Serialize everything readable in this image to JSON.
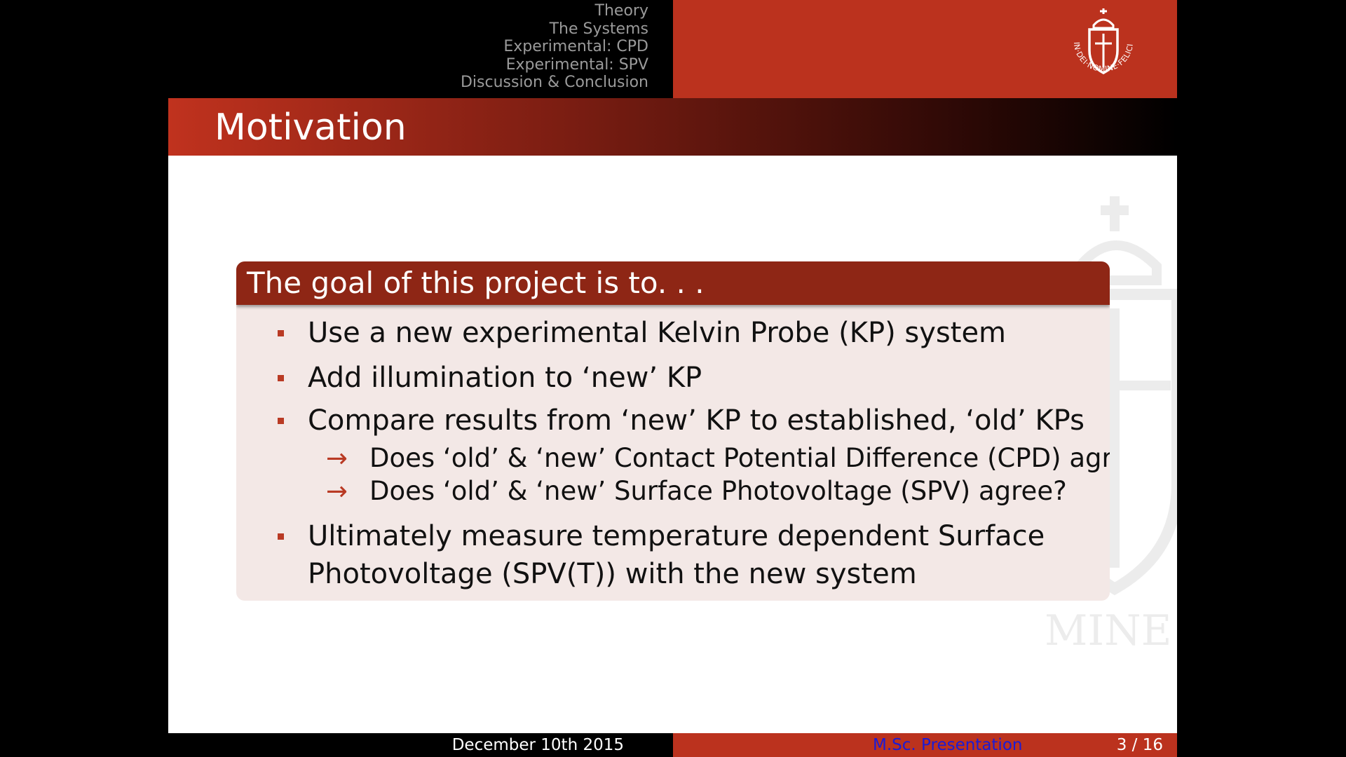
{
  "nav": {
    "sections": [
      "Theory",
      "The Systems",
      "Experimental: CPD",
      "Experimental: SPV",
      "Discussion & Conclusion"
    ]
  },
  "logo": {
    "motto": "IN·DEI·NOMINE·FELICITER",
    "watermark_text": "MINE"
  },
  "frame": {
    "title": "Motivation"
  },
  "block": {
    "title": "The goal of this project is to. . .",
    "items": [
      "Use a new experimental Kelvin Probe (KP) system",
      "Add illumination to ‘new’ KP",
      "Compare results from ‘new’ KP to established, ‘old’ KPs",
      "Ultimately measure temperature dependent Surface",
      "Photovoltage (SPV(T)) with the new system"
    ],
    "sub_items": [
      "Does ‘old’ & ‘new’ Contact Potential Difference (CPD) agree?",
      "Does ‘old’ & ‘new’ Surface Photovoltage (SPV) agree?"
    ],
    "arrow": "→"
  },
  "footer": {
    "date": "December 10th 2015",
    "title": "M.Sc. Presentation",
    "page": "3 / 16"
  },
  "colors": {
    "accent": "#bb321e",
    "block_header": "#8e2615",
    "block_body": "#f3e8e6",
    "footer_link": "#1b1bd6"
  }
}
